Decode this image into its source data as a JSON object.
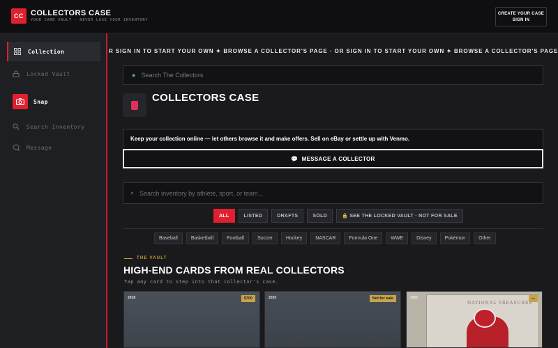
{
  "header": {
    "logo_text": "CC",
    "title": "COLLECTORS CASE",
    "subtitle": "YOUR CARD VAULT — NEVER LOSE YOUR INVENTORY",
    "create_line1": "CREATE YOUR CASE",
    "create_line2": "SIGN IN"
  },
  "sidebar": {
    "items": [
      {
        "label": "Collection",
        "icon": "grid-icon",
        "active": true
      },
      {
        "label": "Locked Vault",
        "icon": "lock-icon"
      },
      {
        "label": "Snap",
        "icon": "camera-icon"
      },
      {
        "label": "Search Inventory",
        "icon": "search-icon"
      },
      {
        "label": "Message",
        "icon": "chat-icon"
      }
    ]
  },
  "marquee": "R SIGN IN TO START YOUR OWN ✦ BROWSE A COLLECTOR'S PAGE · OR SIGN IN TO START YOUR OWN ✦ BROWSE A COLLECTOR'S PAGE · OR SIGN IN T",
  "search": {
    "placeholder": "Search The Collectors"
  },
  "page": {
    "title": "COLLECTORS CASE",
    "description": "Keep your collection online — let others browse it and make offers. Sell on eBay or settle up with Venmo.",
    "message_button": "MESSAGE A COLLECTOR"
  },
  "inventory_search": {
    "placeholder": "Search inventory by athlete, sport, or team..."
  },
  "filters": [
    {
      "label": "ALL",
      "active": true
    },
    {
      "label": "LISTED"
    },
    {
      "label": "DRAFTS"
    },
    {
      "label": "SOLD"
    },
    {
      "label": "🔒 SEE THE LOCKED VAULT · NOT FOR SALE"
    }
  ],
  "sports": [
    "Baseball",
    "Basketball",
    "Football",
    "Soccer",
    "Hockey",
    "NASCAR",
    "Formula One",
    "WWE",
    "Disney",
    "Pokémon",
    "Other"
  ],
  "vault": {
    "label": "THE VAULT",
    "title": "HIGH-END CARDS FROM REAL COLLECTORS",
    "subtitle": "Tap any card to step into that collector's case."
  },
  "cards": [
    {
      "year": "2018",
      "badge": "$700"
    },
    {
      "year": "2020",
      "badge": "Not for sale"
    },
    {
      "year": "2020",
      "badge": "—",
      "banner": "NATIONAL TREASURES"
    }
  ],
  "colors": {
    "accent": "#e0202f",
    "gold": "#c9a34a",
    "background": "#1a1a1d"
  }
}
